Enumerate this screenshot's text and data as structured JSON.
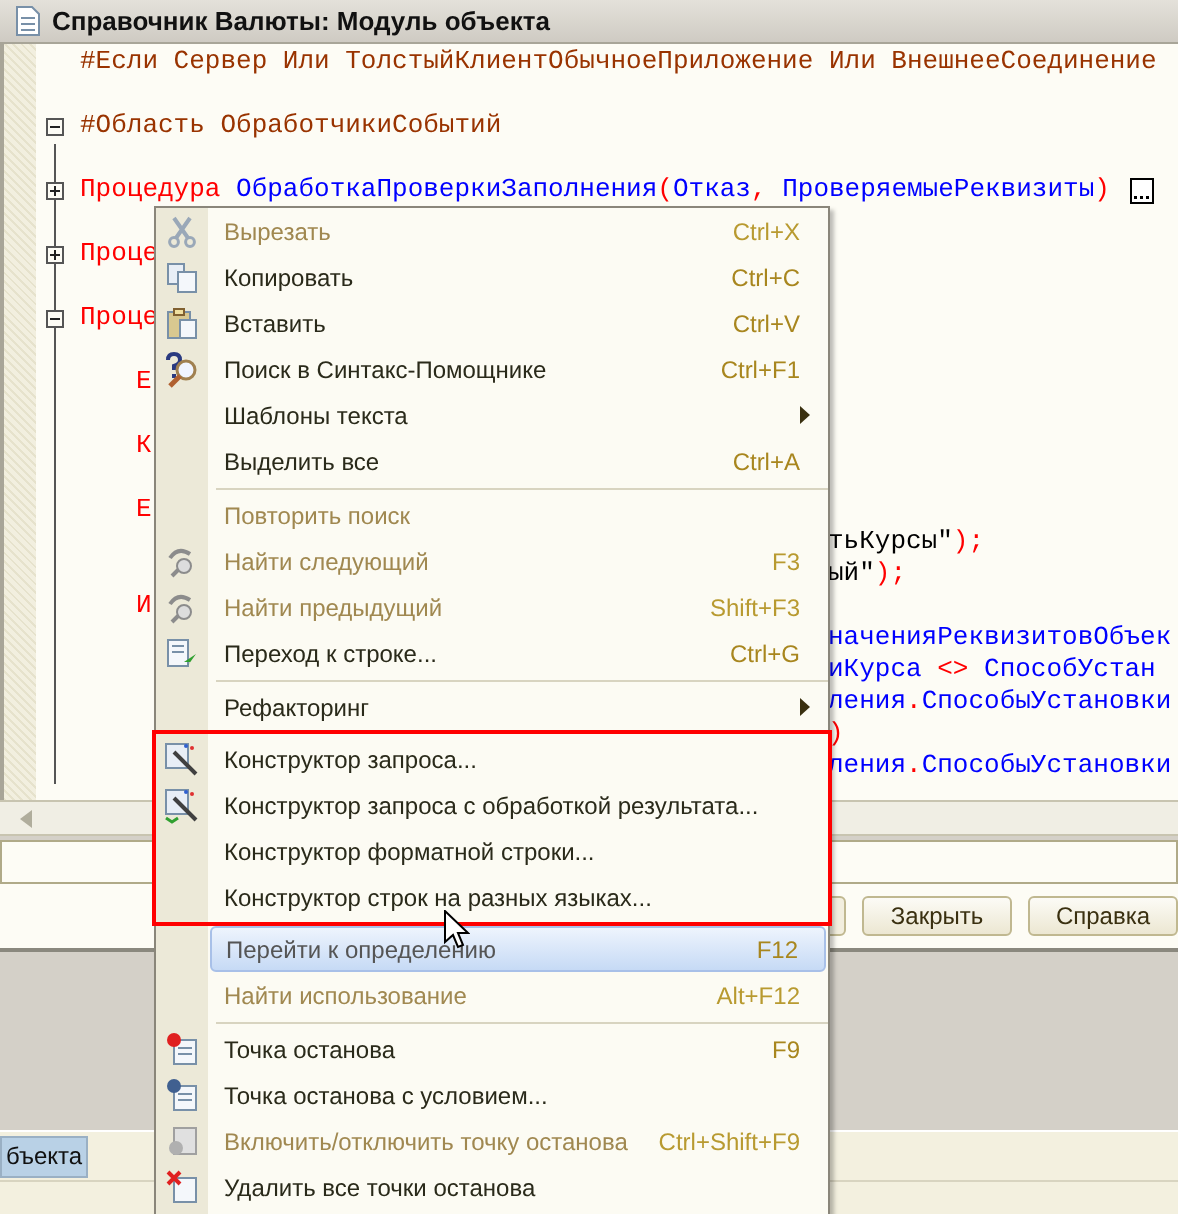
{
  "window": {
    "title": "Справочник Валюты: Модуль объекта"
  },
  "editor": {
    "lines": [
      {
        "kind": "code",
        "left": [
          {
            "kind": "preproc",
            "text": "#Если Сервер Или ТолстыйКлиентОбычноеПриложение Или ВнешнееСоединение"
          }
        ]
      },
      {
        "kind": "blank"
      },
      {
        "kind": "code",
        "expanded": true,
        "left": [
          {
            "kind": "preproc",
            "text": "#Область ОбработчикиСобытий"
          }
        ]
      },
      {
        "kind": "blank"
      },
      {
        "kind": "code",
        "expanded": false,
        "collapsed": true,
        "left": [
          {
            "kind": "keyword",
            "text": "Процедура "
          },
          {
            "kind": "ident",
            "text": "ОбработкаПроверкиЗаполнения"
          },
          {
            "kind": "op",
            "text": "("
          },
          {
            "kind": "ident",
            "text": "Отказ"
          },
          {
            "kind": "op",
            "text": ", "
          },
          {
            "kind": "ident",
            "text": "ПроверяемыеРеквизиты"
          },
          {
            "kind": "op",
            "text": ")"
          }
        ]
      },
      {
        "kind": "blank"
      },
      {
        "kind": "code",
        "expanded": false,
        "left": [
          {
            "kind": "keyword",
            "text": "Проце"
          }
        ]
      },
      {
        "kind": "blank"
      },
      {
        "kind": "code",
        "expanded": true,
        "left": [
          {
            "kind": "keyword",
            "text": "Проце"
          }
        ],
        "children": [
          {
            "kind": "blank"
          },
          {
            "kind": "code",
            "left": [
              {
                "kind": "keyword",
                "text": "Е"
              }
            ]
          },
          {
            "kind": "blank"
          },
          {
            "kind": "code",
            "left": [
              {
                "kind": "keyword",
                "text": "К"
              }
            ]
          },
          {
            "kind": "blank"
          },
          {
            "kind": "code",
            "left": [
              {
                "kind": "keyword",
                "text": "Е"
              }
            ]
          },
          {
            "kind": "code",
            "right": [
              {
                "kind": "string",
                "text": "тьКурсы\""
              },
              {
                "kind": "op",
                "text": ");"
              }
            ]
          },
          {
            "kind": "code",
            "right": [
              {
                "kind": "string",
                "text": "ый\""
              },
              {
                "kind": "op",
                "text": ");"
              }
            ]
          },
          {
            "kind": "code",
            "left": [
              {
                "kind": "keyword",
                "text": "И"
              }
            ]
          },
          {
            "kind": "code",
            "right": [
              {
                "kind": "ident",
                "text": "наченияРеквизитовОбъек"
              }
            ]
          },
          {
            "kind": "code",
            "right": [
              {
                "kind": "ident",
                "text": "иКурса"
              },
              {
                "kind": "op",
                "text": " <> "
              },
              {
                "kind": "ident",
                "text": "СпособУстан"
              }
            ]
          },
          {
            "kind": "code",
            "right": [
              {
                "kind": "ident",
                "text": "ления"
              },
              {
                "kind": "op",
                "text": "."
              },
              {
                "kind": "ident",
                "text": "СпособыУстановки"
              }
            ]
          },
          {
            "kind": "code",
            "right": [
              {
                "kind": "op",
                "text": ")"
              }
            ]
          },
          {
            "kind": "code",
            "right": [
              {
                "kind": "ident",
                "text": "ления"
              },
              {
                "kind": "op",
                "text": "."
              },
              {
                "kind": "ident",
                "text": "СпособыУстановки"
              }
            ]
          }
        ]
      }
    ]
  },
  "buttons": [
    {
      "label": "Закрыть"
    },
    {
      "label": "Справка"
    }
  ],
  "tabs": [
    {
      "label": "бъекта",
      "selected": true
    }
  ],
  "context_menu": {
    "items": [
      {
        "kind": "item",
        "label": "Вырезать",
        "shortcut": "Ctrl+X",
        "disabled": true,
        "selected": false
      },
      {
        "kind": "item",
        "label": "Копировать",
        "shortcut": "Ctrl+C",
        "disabled": false,
        "selected": false
      },
      {
        "kind": "item",
        "label": "Вставить",
        "shortcut": "Ctrl+V",
        "disabled": false,
        "selected": false
      },
      {
        "kind": "item",
        "label": "Поиск в Синтакс-Помощнике",
        "shortcut": "Ctrl+F1",
        "disabled": false,
        "selected": false
      },
      {
        "kind": "item",
        "label": "Шаблоны текста",
        "submenu": true,
        "disabled": false,
        "selected": false
      },
      {
        "kind": "item",
        "label": "Выделить все",
        "shortcut": "Ctrl+A",
        "disabled": false,
        "selected": false
      },
      {
        "kind": "separator"
      },
      {
        "kind": "item",
        "label": "Повторить поиск",
        "disabled": true,
        "selected": false
      },
      {
        "kind": "item",
        "label": "Найти следующий",
        "shortcut": "F3",
        "disabled": true,
        "selected": false
      },
      {
        "kind": "item",
        "label": "Найти предыдущий",
        "shortcut": "Shift+F3",
        "disabled": true,
        "selected": false
      },
      {
        "kind": "item",
        "label": "Переход к строке...",
        "shortcut": "Ctrl+G",
        "disabled": false,
        "selected": false
      },
      {
        "kind": "separator"
      },
      {
        "kind": "item",
        "label": "Рефакторинг",
        "submenu": true,
        "disabled": false,
        "selected": false
      },
      {
        "kind": "highlight",
        "items": [
          {
            "kind": "item",
            "label": "Конструктор запроса...",
            "disabled": false,
            "selected": false
          },
          {
            "kind": "item",
            "label": "Конструктор запроса с обработкой результата...",
            "disabled": false,
            "selected": false
          },
          {
            "kind": "item",
            "label": "Конструктор форматной строки...",
            "disabled": false,
            "selected": false
          },
          {
            "kind": "item",
            "label": "Конструктор строк на разных языках...",
            "disabled": false,
            "selected": false
          }
        ]
      },
      {
        "kind": "item",
        "label": "Перейти к определению",
        "shortcut": "F12",
        "disabled": false,
        "selected": true
      },
      {
        "kind": "item",
        "label": "Найти использование",
        "shortcut": "Alt+F12",
        "disabled": true,
        "selected": false
      },
      {
        "kind": "separator"
      },
      {
        "kind": "item",
        "label": "Точка останова",
        "shortcut": "F9",
        "disabled": false,
        "selected": false
      },
      {
        "kind": "item",
        "label": "Точка останова с условием...",
        "disabled": false,
        "selected": false
      },
      {
        "kind": "item",
        "label": "Включить/отключить точку останова",
        "shortcut": "Ctrl+Shift+F9",
        "disabled": true,
        "selected": false
      },
      {
        "kind": "item",
        "label": "Удалить все точки останова",
        "disabled": false,
        "selected": false
      }
    ]
  }
}
